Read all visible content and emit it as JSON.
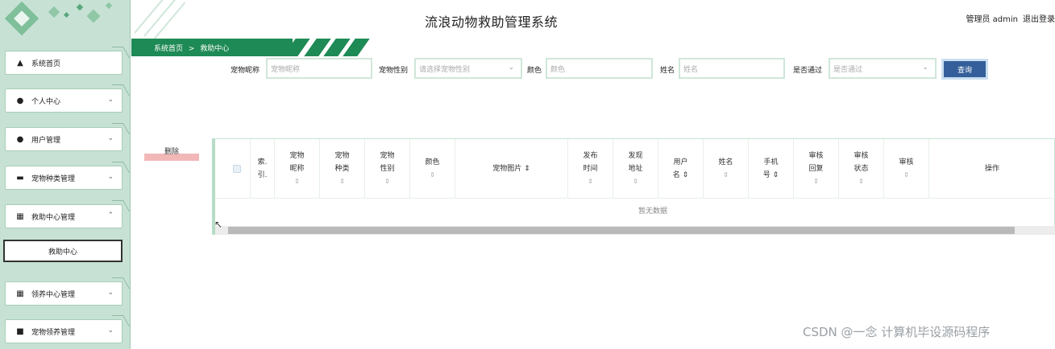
{
  "header": {
    "title": "流浪动物救助管理系统",
    "admin_label": "管理员 admin",
    "logout_label": "退出登录"
  },
  "breadcrumb": {
    "home": "系统首页",
    "separator": ">",
    "current": "救助中心"
  },
  "sidebar": {
    "items": [
      {
        "label": "系统首页",
        "icon": "home-icon"
      },
      {
        "label": "个人中心",
        "icon": "person-icon"
      },
      {
        "label": "用户管理",
        "icon": "person-icon"
      },
      {
        "label": "宠物种类管理",
        "icon": "monitor-icon"
      },
      {
        "label": "救助中心管理",
        "icon": "grid-icon"
      },
      {
        "label": "救助中心",
        "icon": ""
      },
      {
        "label": "领养中心管理",
        "icon": "grid-icon"
      },
      {
        "label": "宠物领养管理",
        "icon": "document-icon"
      }
    ]
  },
  "search": {
    "nickname_label": "宠物昵称",
    "nickname_placeholder": "宠物昵称",
    "gender_label": "宠物性别",
    "gender_placeholder": "请选择宠物性别",
    "color_label": "颜色",
    "color_placeholder": "颜色",
    "name_label": "姓名",
    "name_placeholder": "姓名",
    "approved_label": "是否通过",
    "approved_placeholder": "是否通过",
    "query_label": "查询"
  },
  "actions": {
    "delete_label": "删除"
  },
  "table": {
    "columns": [
      {
        "line1": "索.",
        "line2": "引.",
        "sort": ""
      },
      {
        "line1": "宠物",
        "line2": "昵称",
        "sort": "⇕"
      },
      {
        "line1": "宠物",
        "line2": "种类",
        "sort": "⇕"
      },
      {
        "line1": "宠物",
        "line2": "性别",
        "sort": "⇕"
      },
      {
        "line1": "颜色",
        "line2": "",
        "sort": "⇕"
      },
      {
        "line1": "宠物图片 ⇕",
        "line2": "",
        "sort": ""
      },
      {
        "line1": "发布",
        "line2": "时间",
        "sort": "⇕"
      },
      {
        "line1": "发现",
        "line2": "地址",
        "sort": "⇕"
      },
      {
        "line1": "用户",
        "line2": "名 ⇕",
        "sort": ""
      },
      {
        "line1": "姓名",
        "line2": "",
        "sort": "⇕"
      },
      {
        "line1": "手机",
        "line2": "号 ⇕",
        "sort": ""
      },
      {
        "line1": "审核",
        "line2": "回复",
        "sort": "⇕"
      },
      {
        "line1": "审核",
        "line2": "状态",
        "sort": "⇕"
      },
      {
        "line1": "审核",
        "line2": "",
        "sort": "⇕"
      },
      {
        "line1": "操作",
        "line2": "",
        "sort": ""
      }
    ],
    "empty_text": "暂无数据"
  },
  "watermark": "CSDN @一念 计算机毕设源码程序"
}
